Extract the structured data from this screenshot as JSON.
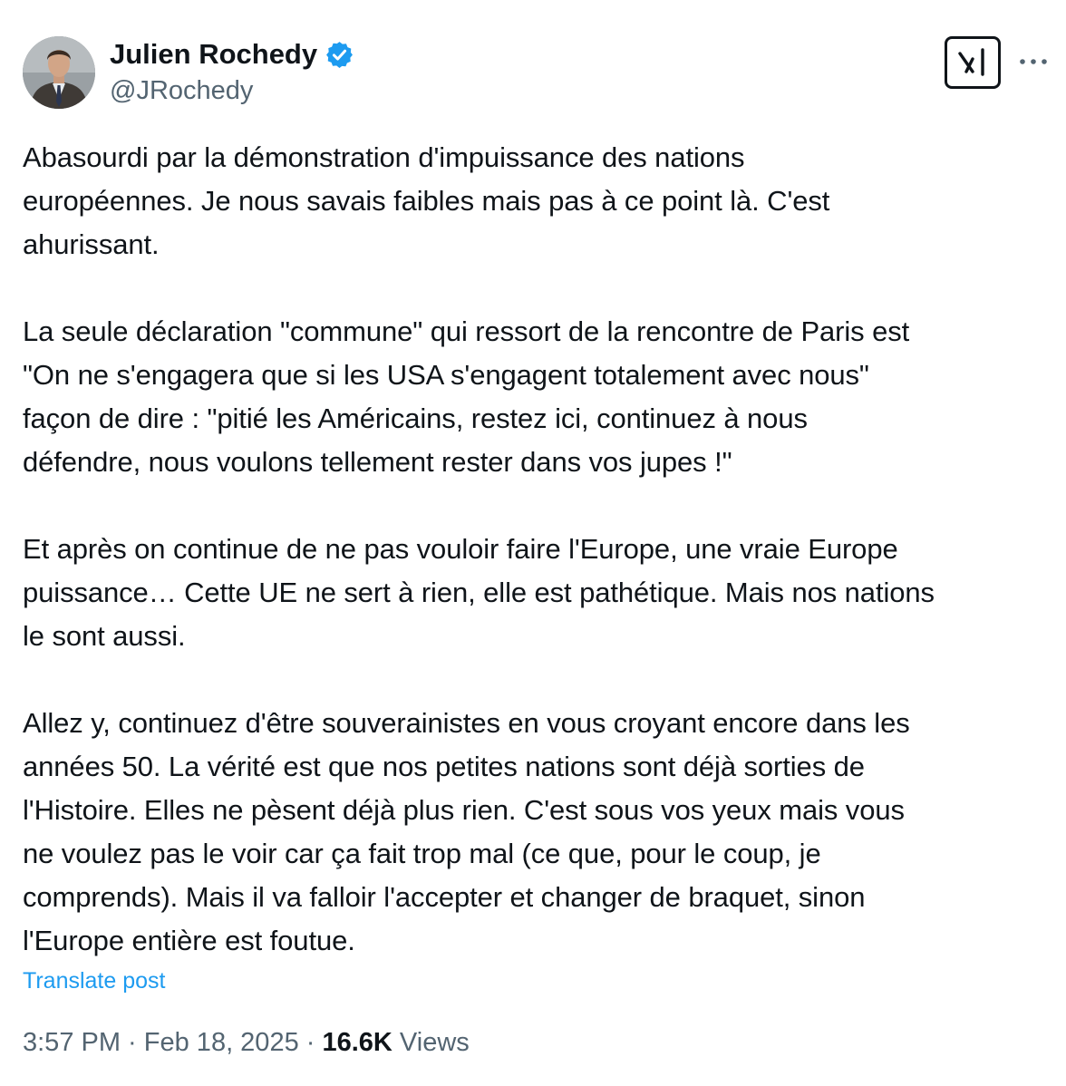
{
  "author": {
    "name": "Julien Rochedy",
    "handle": "@JRochedy",
    "verified": true
  },
  "icons": {
    "verified": "verified-badge-icon",
    "grok": "grok-logo-icon",
    "more": "more-options-icon"
  },
  "colors": {
    "accent": "#1d9bf0",
    "text_primary": "#0f1419",
    "text_secondary": "#536471"
  },
  "post": {
    "paragraphs": [
      "Abasourdi par la démonstration d'impuissance des nations\neuropéennes. Je nous savais faibles mais pas à ce point là. C'est\nahurissant.",
      "La seule déclaration \"commune\" qui ressort de la rencontre de Paris est\n\"On ne s'engagera que si les USA s'engagent totalement avec nous\"\nfaçon de dire : \"pitié les Américains, restez ici, continuez à nous\ndéfendre, nous voulons tellement rester dans vos jupes !\"",
      "Et après on continue de ne pas vouloir faire l'Europe, une vraie Europe\npuissance… Cette UE ne sert à rien, elle est pathétique. Mais nos nations\nle sont aussi.",
      "Allez y, continuez d'être souverainistes en vous croyant encore dans les\nannées 50. La vérité est que nos petites nations sont déjà sorties de\nl'Histoire. Elles ne pèsent déjà plus rien. C'est sous vos yeux mais vous\nne voulez pas le voir car ça fait trop mal (ce que, pour le coup, je\ncomprends). Mais il va falloir l'accepter et changer de braquet, sinon\nl'Europe entière est foutue."
    ],
    "translate_label": "Translate post"
  },
  "meta": {
    "time": "3:57 PM",
    "separator": " · ",
    "date": "Feb 18, 2025",
    "views_count": "16.6K",
    "views_label": " Views"
  }
}
